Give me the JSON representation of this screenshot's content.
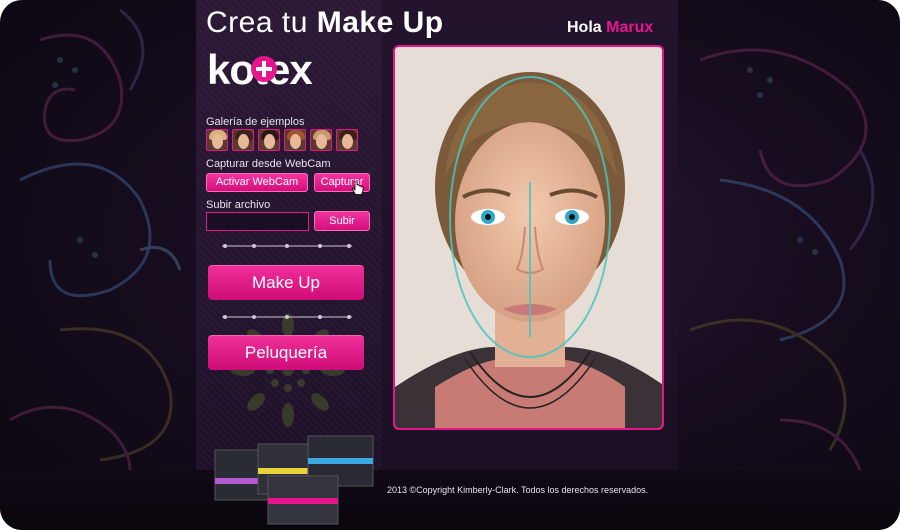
{
  "header": {
    "title_thin": "Crea tu ",
    "title_bold": "Make Up",
    "greeting_prefix": "Hola ",
    "user_name": "Marux",
    "brand": "kotex"
  },
  "sidebar": {
    "gallery_label": "Galería de ejemplos",
    "gallery_thumbs": [
      {
        "hair": "#d9b07a"
      },
      {
        "hair": "#3a2418"
      },
      {
        "hair": "#2a1a12"
      },
      {
        "hair": "#a2552c"
      },
      {
        "hair": "#c89a6a"
      },
      {
        "hair": "#3b2016"
      }
    ],
    "webcam_label": "Capturar desde WebCam",
    "activate_webcam_label": "Activar WebCam",
    "capture_label": "Capturar",
    "upload_label": "Subir archivo",
    "upload_value": "",
    "upload_button_label": "Subir",
    "makeup_button_label": "Make Up",
    "hair_button_label": "Peluquería"
  },
  "footer": {
    "copyright": "2013 ©Copyright Kimberly-Clark. Todos los derechos reservados."
  },
  "colors": {
    "accent": "#e5158b",
    "background": "#170d1f"
  }
}
